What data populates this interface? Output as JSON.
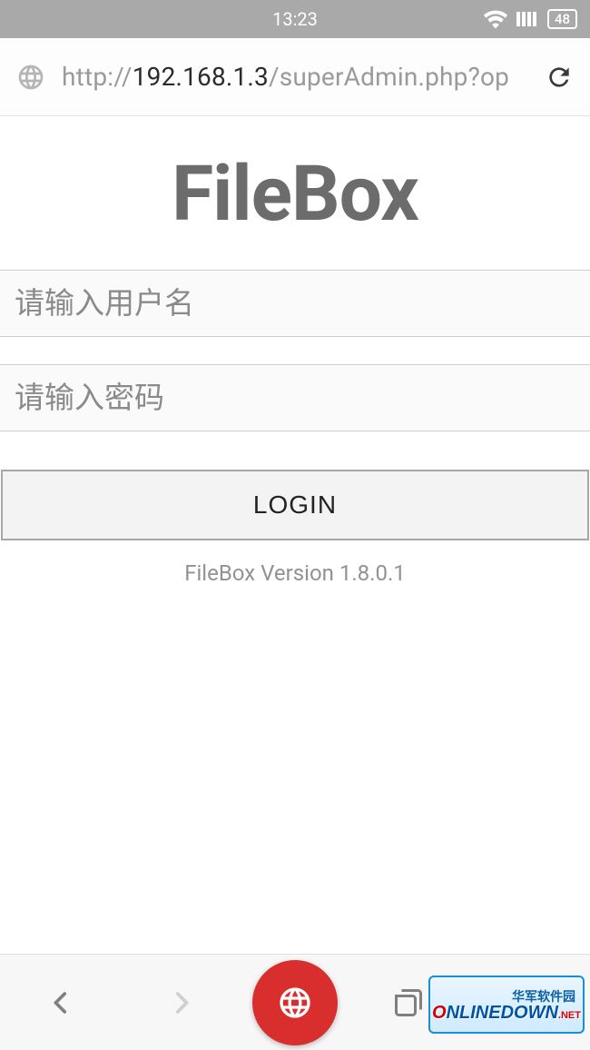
{
  "status": {
    "time": "13:23",
    "battery": "48"
  },
  "address": {
    "prefix": "http://",
    "host": "192.168.1.3",
    "path": "/superAdmin.php?op"
  },
  "app": {
    "title": "FileBox",
    "username_placeholder": "请输入用户名",
    "password_placeholder": "请输入密码",
    "login_label": "LOGIN",
    "version_text": "FileBox Version 1.8.0.1"
  },
  "watermark": {
    "top": "华军软件园",
    "main_prefix": "O",
    "main_rest": "NLINEDOWN",
    "main_suffix": ".NET"
  }
}
